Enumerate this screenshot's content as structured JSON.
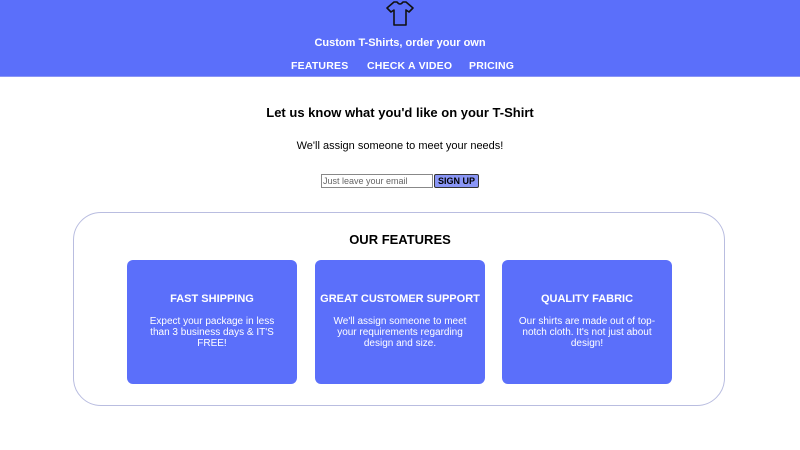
{
  "header": {
    "logo_icon": "tshirt-icon",
    "tagline": "Custom T-Shirts, order your own",
    "nav": [
      {
        "label": "FEATURES"
      },
      {
        "label": "CHECK A VIDEO"
      },
      {
        "label": "PRICING"
      }
    ]
  },
  "hero": {
    "title": "Let us know what you'd like on your T-Shirt",
    "subtitle": "We'll assign someone to meet your needs!",
    "email_placeholder": "Just leave your email",
    "signup_label": "SIGN UP"
  },
  "features": {
    "title": "OUR FEATURES",
    "cards": [
      {
        "title": "FAST SHIPPING",
        "text": "Expect your package in less than 3 business days & IT'S FREE!"
      },
      {
        "title": "GREAT CUSTOMER SUPPORT",
        "text": "We'll assign someone to meet your requirements regarding design and size."
      },
      {
        "title": "QUALITY FABRIC",
        "text": "Our shirts are made out of top-notch cloth. It's not just about design!"
      }
    ]
  },
  "colors": {
    "brand": "#5b6ffa",
    "button": "#8a96f5",
    "box_border": "#b9bde0"
  }
}
